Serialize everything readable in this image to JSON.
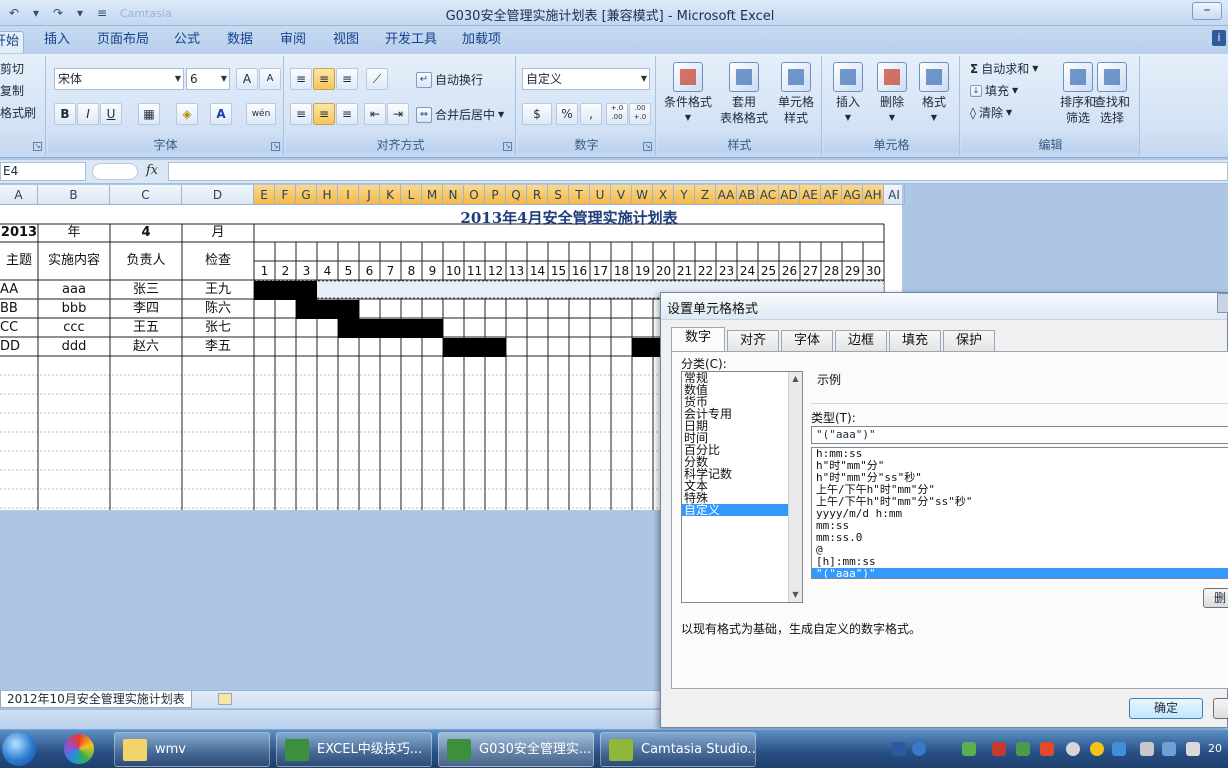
{
  "window": {
    "title": "G030安全管理实施计划表 [兼容模式] - Microsoft Excel",
    "qat_hint": "Camtasia"
  },
  "tabs": [
    "开始",
    "插入",
    "页面布局",
    "公式",
    "数据",
    "审阅",
    "视图",
    "开发工具",
    "加载项"
  ],
  "ribbon": {
    "clipboard": {
      "cut": "剪切",
      "copy": "复制",
      "painter": "格式刷"
    },
    "font": {
      "name": "宋体",
      "size": "6",
      "grow": "A",
      "shrink": "A",
      "bold": "B",
      "italic": "I",
      "underline": "U",
      "wen": "wén",
      "label": "字体"
    },
    "alignment": {
      "wrap": "自动换行",
      "merge": "合并后居中",
      "label": "对齐方式"
    },
    "number": {
      "format": "自定义",
      "label": "数字",
      "percent": "%",
      "comma": ",",
      "inc": "+.0 .00",
      "dec": ".00 +.0"
    },
    "styles": {
      "conditional": "条件格式",
      "table1": "套用",
      "table2": "表格格式",
      "cell1": "单元格",
      "cell2": "样式",
      "label": "样式"
    },
    "cells": {
      "insert": "插入",
      "delete": "删除",
      "format": "格式",
      "label": "单元格"
    },
    "editing": {
      "autosum": "自动求和",
      "fill": "填充",
      "clear": "清除",
      "sort1": "排序和",
      "sort2": "筛选",
      "find1": "查找和",
      "find2": "选择",
      "label": "编辑"
    }
  },
  "formula_bar": {
    "name_box": "E4",
    "fx": "fx"
  },
  "sheet": {
    "columns": [
      "A",
      "B",
      "C",
      "D",
      "E",
      "F",
      "G",
      "H",
      "I",
      "J",
      "K",
      "L",
      "M",
      "N",
      "O",
      "P",
      "Q",
      "R",
      "S",
      "T",
      "U",
      "V",
      "W",
      "X",
      "Y",
      "Z",
      "AA",
      "AB",
      "AC",
      "AD",
      "AE",
      "AF",
      "AG",
      "AH",
      "AI"
    ],
    "title": "2013年4月安全管理实施计划表",
    "header_row1": [
      "2013",
      "年",
      "4",
      "月"
    ],
    "header_row2": [
      "主题",
      "实施内容",
      "负责人",
      "检查"
    ],
    "days": [
      "1",
      "2",
      "3",
      "4",
      "5",
      "6",
      "7",
      "8",
      "9",
      "10",
      "11",
      "12",
      "13",
      "14",
      "15",
      "16",
      "17",
      "18",
      "19",
      "20",
      "21",
      "22",
      "23",
      "24",
      "25",
      "26",
      "27",
      "28",
      "29",
      "30"
    ],
    "rows": [
      {
        "topic": "AA",
        "content": "aaa",
        "owner": "张三",
        "checker": "王九",
        "start": 1,
        "end": 3
      },
      {
        "topic": "BB",
        "content": "bbb",
        "owner": "李四",
        "checker": "陈六",
        "start": 3,
        "end": 5
      },
      {
        "topic": "CC",
        "content": "ccc",
        "owner": "王五",
        "checker": "张七",
        "start": 5,
        "end": 9
      },
      {
        "topic": "DD",
        "content": "ddd",
        "owner": "赵六",
        "checker": "李五",
        "start": 10,
        "end": 12,
        "start2": 19,
        "end2": 20
      }
    ],
    "tab_name": "2012年10月安全管理实施计划表"
  },
  "dialog": {
    "title": "设置单元格格式",
    "tabs": [
      "数字",
      "对齐",
      "字体",
      "边框",
      "填充",
      "保护"
    ],
    "category_label": "分类(C):",
    "categories": [
      "常规",
      "数值",
      "货币",
      "会计专用",
      "日期",
      "时间",
      "百分比",
      "分数",
      "科学记数",
      "文本",
      "特殊",
      "自定义"
    ],
    "sample_label": "示例",
    "type_label": "类型(T):",
    "type_value": "\"(\"aaa\")\"",
    "types": [
      "h:mm:ss",
      "h\"时\"mm\"分\"",
      "h\"时\"mm\"分\"ss\"秒\"",
      "上午/下午h\"时\"mm\"分\"",
      "上午/下午h\"时\"mm\"分\"ss\"秒\"",
      "yyyy/m/d h:mm",
      "mm:ss",
      "mm:ss.0",
      "@",
      "[h]:mm:ss",
      "\"(\"aaa\")\""
    ],
    "delete_btn": "删",
    "description": "以现有格式为基础，生成自定义的数字格式。",
    "ok": "确定"
  },
  "taskbar": {
    "items": [
      "wmv",
      "EXCEL中级技巧...",
      "G030安全管理实...",
      "Camtasia Studio..."
    ],
    "clock": "20"
  }
}
